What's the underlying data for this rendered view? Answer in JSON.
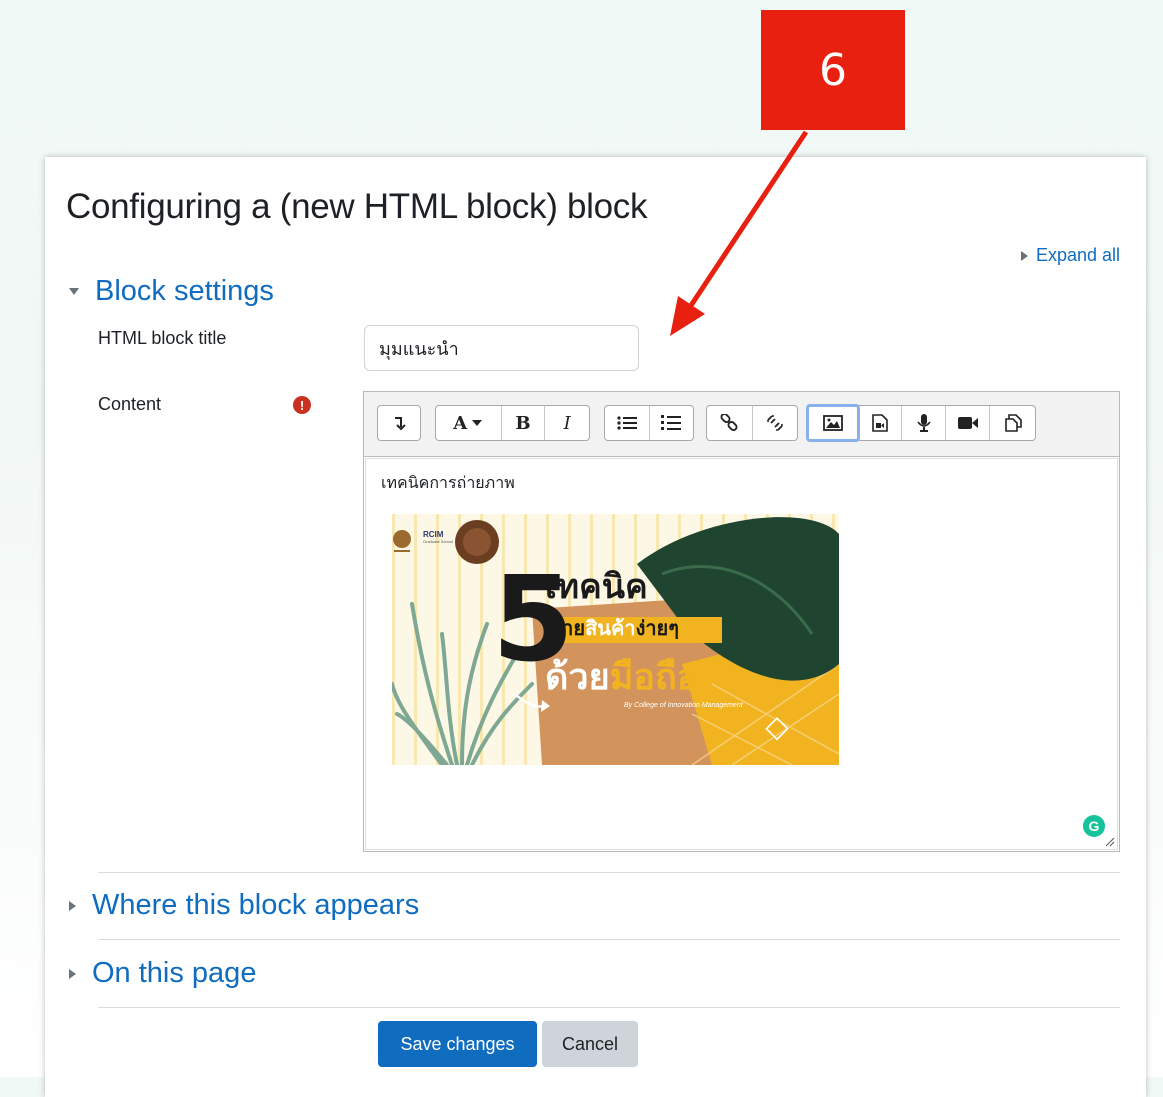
{
  "annotation": {
    "step_number": "6",
    "color": "#e8200f"
  },
  "page": {
    "title": "Configuring a (new HTML block) block",
    "expand_all": "Expand all"
  },
  "sections": {
    "block_settings": "Block settings",
    "where_appears": "Where this block appears",
    "on_this_page": "On this page"
  },
  "form": {
    "title_label": "HTML block title",
    "title_value": "มุมแนะนำ",
    "content_label": "Content",
    "required_icon": "!"
  },
  "editor": {
    "toolbar_icons": [
      "collapse-icon",
      "font-style-icon",
      "bold-icon",
      "italic-icon",
      "unordered-list-icon",
      "ordered-list-icon",
      "link-icon",
      "unlink-icon",
      "image-icon",
      "media-icon",
      "record-audio-icon",
      "record-video-icon",
      "manage-files-icon"
    ],
    "active_button": "image-icon",
    "content_text": "เทคนิคการถ่ายภาพ",
    "grammarly_glyph": "G"
  },
  "banner": {
    "logo_text": "RCIM",
    "logo_sub": "Graduate School",
    "number": "5",
    "line1": "เทคนิค",
    "line2a": "ถ่าย",
    "line2b": "สินค้า",
    "line2c": "ง่ายๆ",
    "line3a": "ด้วย",
    "line3b": "มือถือ",
    "byline": "By College of Innovation Management"
  },
  "actions": {
    "save": "Save changes",
    "cancel": "Cancel"
  },
  "colors": {
    "link": "#0f6cbf",
    "primary": "#0f6cbf",
    "secondary": "#ced4da",
    "required": "#ca3120"
  }
}
